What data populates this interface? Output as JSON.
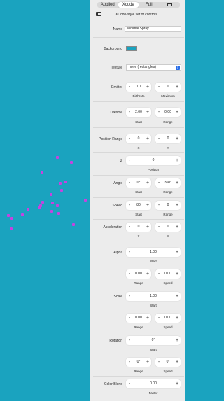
{
  "tabs": [
    "Applied",
    "Xcode",
    "Full"
  ],
  "subtitle": "XCode-style set of controls",
  "name_label": "Name",
  "name_value": "Minimal Spray",
  "background_label": "Background",
  "background_color": "#1aa3bf",
  "texture_label": "Texture",
  "texture_value": "none (rectangles)",
  "emitter": {
    "label": "Emitter",
    "birthrate": "10",
    "maximum": "0",
    "cap1": "Birthrate",
    "cap2": "Maximum"
  },
  "lifetime": {
    "label": "Lifetime",
    "start": "2.00",
    "range": "0.00",
    "cap1": "Start",
    "cap2": "Range"
  },
  "position_range": {
    "label": "Position Range",
    "x": "0",
    "y": "0",
    "cap1": "X",
    "cap2": "Y"
  },
  "z": {
    "label": "Z",
    "value": "0",
    "cap": "Position"
  },
  "angle": {
    "label": "Angle",
    "start": "0°",
    "range": "360°",
    "cap1": "Start",
    "cap2": "Range"
  },
  "speed": {
    "label": "Speed",
    "start": "80",
    "range": "0",
    "cap1": "Start",
    "cap2": "Range"
  },
  "acceleration": {
    "label": "Acceleration",
    "x": "0",
    "y": "0",
    "cap1": "X",
    "cap2": "Y"
  },
  "alpha": {
    "label": "Alpha",
    "start": "1.00",
    "cap": "Start",
    "range": "0.00",
    "speed": "0.00",
    "cap1": "Range",
    "cap2": "Speed"
  },
  "scale": {
    "label": "Scale",
    "start": "1.00",
    "cap": "Start",
    "range": "0.00",
    "speed": "0.00",
    "cap1": "Range",
    "cap2": "Speed"
  },
  "rotation": {
    "label": "Rotation",
    "start": "0°",
    "cap": "Start",
    "range": "0°",
    "speed": "0°",
    "cap1": "Range",
    "cap2": "Speed"
  },
  "color_blend": {
    "label": "Color Blend",
    "factor": "0.00",
    "cap": "Factor"
  },
  "particle_color": "#c643e0"
}
